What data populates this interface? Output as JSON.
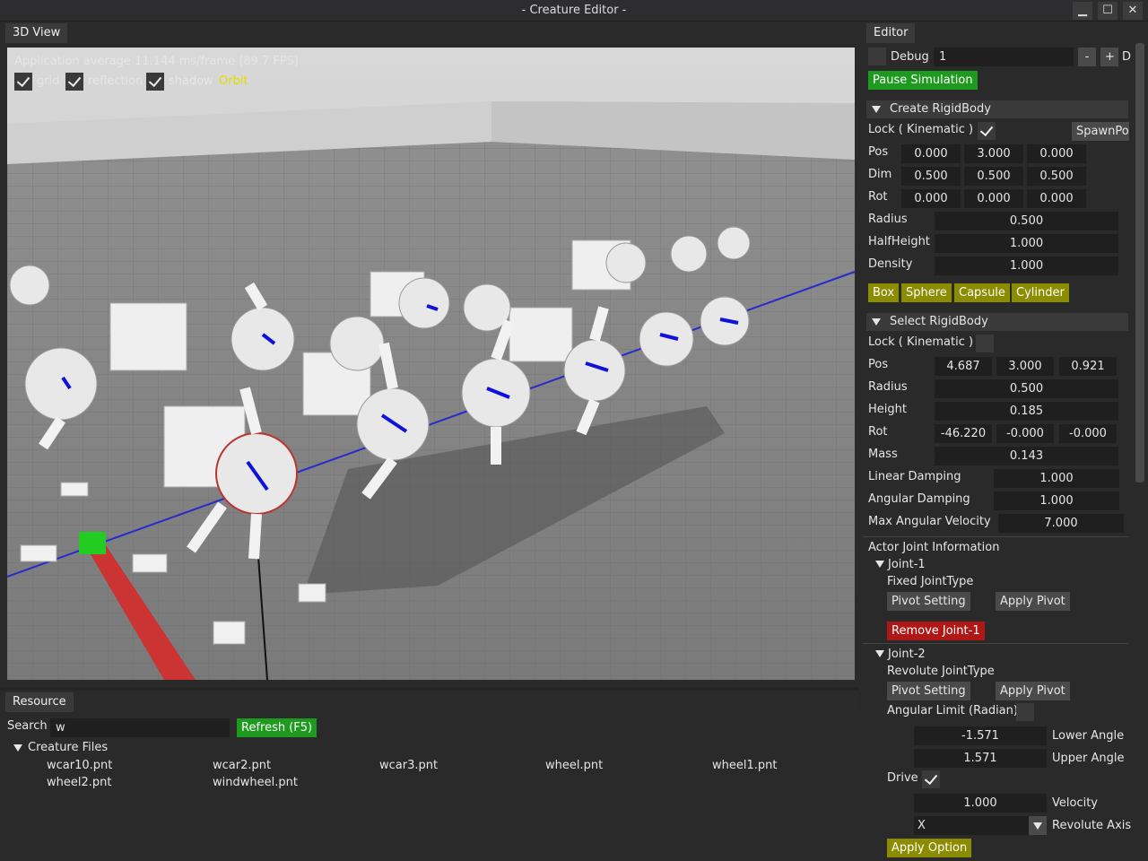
{
  "window": {
    "title": "- Creature Editor -",
    "min_glyph": "▁",
    "max_glyph": "☐",
    "close_glyph": "✕"
  },
  "view3d": {
    "tab": "3D View",
    "fps_text": "Application average 11.144 ms/frame (89.7 FPS)",
    "grid_label": "grid",
    "reflection_label": "reflection",
    "shadow_label": "shadow",
    "camera_mode": "Orbit",
    "grid_checked": true,
    "reflection_checked": true,
    "shadow_checked": true
  },
  "resource": {
    "tab": "Resource",
    "search_label": "Search",
    "search_value": "w",
    "refresh_label": "Refresh (F5)",
    "tree_label": "Creature Files",
    "files": [
      "wcar10.pnt",
      "wcar2.pnt",
      "wcar3.pnt",
      "wheel.pnt",
      "wheel1.pnt",
      "wheel2.pnt",
      "windwheel.pnt"
    ]
  },
  "editor": {
    "tab": "Editor",
    "debug_label": "Debug",
    "debug_value": "1",
    "minus": "-",
    "plus": "+",
    "d_label": "D",
    "pause_label": "Pause Simulation",
    "create": {
      "header": "Create RigidBody",
      "lock_label": "Lock ( Kinematic )",
      "lock_checked": true,
      "spawnpos_label": "SpawnPos",
      "pos_label": "Pos",
      "pos": [
        "0.000",
        "3.000",
        "0.000"
      ],
      "dim_label": "Dim",
      "dim": [
        "0.500",
        "0.500",
        "0.500"
      ],
      "rot_label": "Rot",
      "rot": [
        "0.000",
        "0.000",
        "0.000"
      ],
      "radius_label": "Radius",
      "radius": "0.500",
      "halfheight_label": "HalfHeight",
      "halfheight": "1.000",
      "density_label": "Density",
      "density": "1.000",
      "shapes": [
        "Box",
        "Sphere",
        "Capsule",
        "Cylinder"
      ]
    },
    "select": {
      "header": "Select RigidBody",
      "lock_label": "Lock ( Kinematic )",
      "lock_checked": false,
      "pos_label": "Pos",
      "pos": [
        "4.687",
        "3.000",
        "0.921"
      ],
      "radius_label": "Radius",
      "radius": "0.500",
      "height_label": "Height",
      "height": "0.185",
      "rot_label": "Rot",
      "rot": [
        "-46.220",
        "-0.000",
        "-0.000"
      ],
      "mass_label": "Mass",
      "mass": "0.143",
      "lin_damp_label": "Linear Damping",
      "lin_damp": "1.000",
      "ang_damp_label": "Angular Damping",
      "ang_damp": "1.000",
      "max_ang_vel_label": "Max Angular Velocity",
      "max_ang_vel": "7.000"
    },
    "joints": {
      "header": "Actor Joint Information",
      "joint1": {
        "name": "Joint-1",
        "type": "Fixed JointType",
        "pivot_label": "Pivot Setting",
        "apply_pivot_label": "Apply Pivot",
        "remove_label": "Remove Joint-1"
      },
      "joint2": {
        "name": "Joint-2",
        "type": "Revolute JointType",
        "pivot_label": "Pivot Setting",
        "apply_pivot_label": "Apply Pivot",
        "angular_limit_label": "Angular Limit (Radian)",
        "lower": "-1.571",
        "lower_label": "Lower Angle",
        "upper": "1.571",
        "upper_label": "Upper Angle",
        "drive_label": "Drive",
        "drive_checked": true,
        "velocity": "1.000",
        "velocity_label": "Velocity",
        "axis": "X",
        "axis_label": "Revolute Axis",
        "apply_option_label": "Apply Option"
      }
    }
  }
}
